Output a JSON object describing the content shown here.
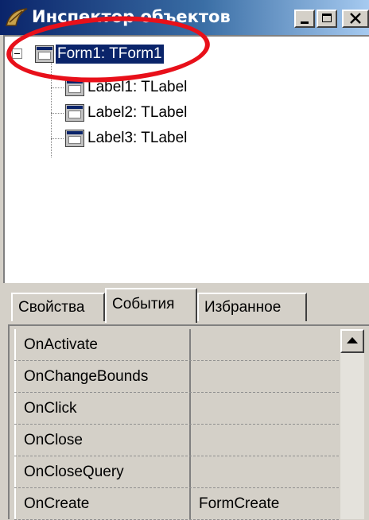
{
  "window": {
    "title": "Инспектор объектов",
    "controls": {
      "minimize_icon": "minimize-icon",
      "maximize_icon": "maximize-icon",
      "close_icon": "close-icon"
    }
  },
  "tree": {
    "root": {
      "label": "Form1: TForm1",
      "selected": true,
      "expanded": true
    },
    "children": [
      {
        "label": "Label1: TLabel"
      },
      {
        "label": "Label2: TLabel"
      },
      {
        "label": "Label3: TLabel"
      }
    ]
  },
  "tabs": [
    {
      "label": "Свойства",
      "active": false
    },
    {
      "label": "События",
      "active": true
    },
    {
      "label": "Избранное",
      "active": false
    }
  ],
  "events": [
    {
      "name": "OnActivate",
      "value": ""
    },
    {
      "name": "OnChangeBounds",
      "value": ""
    },
    {
      "name": "OnClick",
      "value": ""
    },
    {
      "name": "OnClose",
      "value": ""
    },
    {
      "name": "OnCloseQuery",
      "value": ""
    },
    {
      "name": "OnCreate",
      "value": "FormCreate"
    }
  ],
  "colors": {
    "selection": "#0a246a",
    "annotation": "#e8101a",
    "face": "#d4d0c8"
  }
}
